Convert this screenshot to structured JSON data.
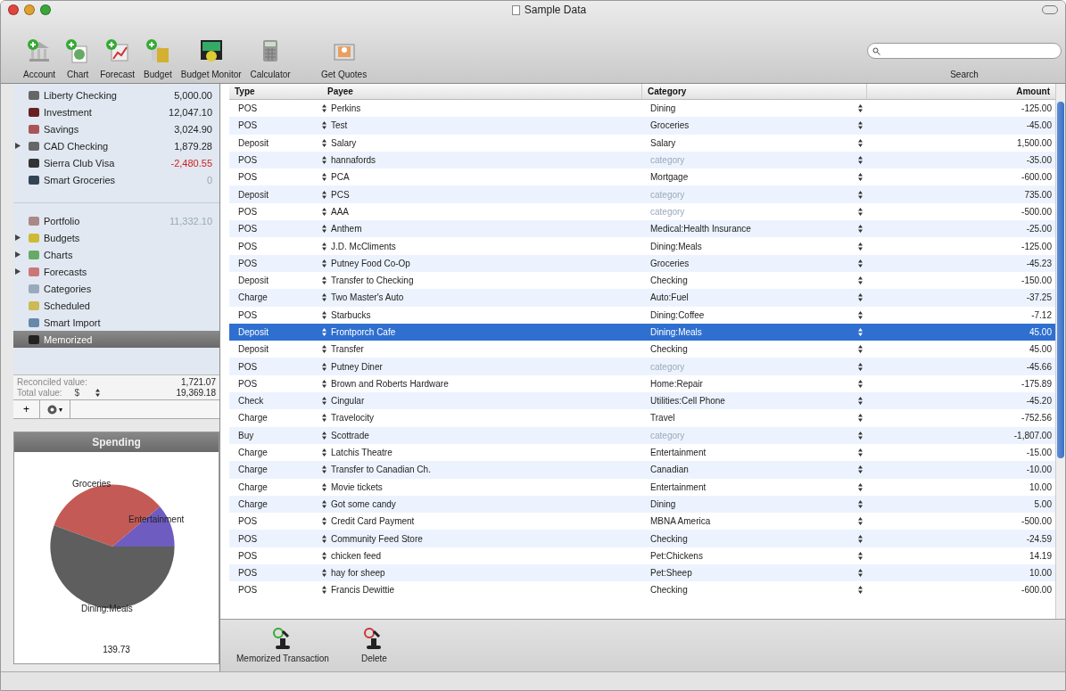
{
  "window": {
    "title": "Sample Data"
  },
  "toolbar": {
    "buttons": [
      {
        "label": "Account"
      },
      {
        "label": "Chart"
      },
      {
        "label": "Forecast"
      },
      {
        "label": "Budget"
      },
      {
        "label": "Budget Monitor"
      },
      {
        "label": "Calculator"
      },
      {
        "label": "Get Quotes"
      }
    ],
    "search": {
      "label": "Search"
    }
  },
  "sidebar": {
    "accounts": [
      {
        "label": "Liberty Checking",
        "amount": "5,000.00",
        "negative": false,
        "dimmed": false,
        "expandable": false,
        "selected": false
      },
      {
        "label": "Investment",
        "amount": "12,047.10",
        "negative": false,
        "dimmed": false,
        "expandable": false,
        "selected": false
      },
      {
        "label": "Savings",
        "amount": "3,024.90",
        "negative": false,
        "dimmed": false,
        "expandable": false,
        "selected": false
      },
      {
        "label": "CAD Checking",
        "amount": "1,879.28",
        "negative": false,
        "dimmed": false,
        "expandable": true,
        "selected": false
      },
      {
        "label": "Sierra Club Visa",
        "amount": "-2,480.55",
        "negative": true,
        "dimmed": false,
        "expandable": false,
        "selected": false
      },
      {
        "label": "Smart Groceries",
        "amount": "0",
        "negative": false,
        "dimmed": true,
        "expandable": false,
        "selected": false
      }
    ],
    "items": [
      {
        "label": "Portfolio",
        "amount": "11,332.10",
        "negative": false,
        "dimmed": true,
        "expandable": false,
        "selected": false
      },
      {
        "label": "Budgets",
        "expandable": true,
        "selected": false
      },
      {
        "label": "Charts",
        "expandable": true,
        "selected": false
      },
      {
        "label": "Forecasts",
        "expandable": true,
        "selected": false
      },
      {
        "label": "Categories",
        "expandable": false,
        "selected": false
      },
      {
        "label": "Scheduled",
        "expandable": false,
        "selected": false
      },
      {
        "label": "Smart Import",
        "expandable": false,
        "selected": false
      },
      {
        "label": "Memorized",
        "expandable": false,
        "selected": true
      }
    ],
    "summary": {
      "reconciled_label": "Reconciled value:",
      "reconciled": "1,721.07",
      "total_label": "Total value:",
      "currency": "$",
      "total": "19,369.18"
    },
    "actions": [
      {
        "label": "+"
      },
      {
        "label": "▾"
      }
    ]
  },
  "spending": {
    "title": "Spending",
    "slices": [
      {
        "label": "Groceries",
        "color": "#c45a55"
      },
      {
        "label": "Entertainment",
        "color": "#6e5cc0"
      },
      {
        "label": "Dining:Meals",
        "color": "#5e5e5e"
      }
    ],
    "total": "139.73"
  },
  "table": {
    "columns": [
      "Type",
      "Payee",
      "Category",
      "Amount"
    ],
    "rows": [
      {
        "type": "POS",
        "payee": "Perkins",
        "category": "Dining",
        "amount": "-125.00",
        "selected": false
      },
      {
        "type": "POS",
        "payee": "Test",
        "category": "Groceries",
        "amount": "-45.00",
        "selected": false
      },
      {
        "type": "Deposit",
        "payee": "Salary",
        "category": "Salary",
        "amount": "1,500.00",
        "selected": false
      },
      {
        "type": "POS",
        "payee": "hannafords",
        "category_placeholder": "category",
        "amount": "-35.00",
        "selected": false
      },
      {
        "type": "POS",
        "payee": "PCA",
        "category": "Mortgage",
        "amount": "-600.00",
        "selected": false
      },
      {
        "type": "Deposit",
        "payee": "PCS",
        "category_placeholder": "category",
        "amount": "735.00",
        "selected": false
      },
      {
        "type": "POS",
        "payee": "AAA",
        "category_placeholder": "category",
        "amount": "-500.00",
        "selected": false
      },
      {
        "type": "POS",
        "payee": "Anthem",
        "category": "Medical:Health Insurance",
        "amount": "-25.00",
        "selected": false
      },
      {
        "type": "POS",
        "payee": "J.D. McCliments",
        "category": "Dining:Meals",
        "amount": "-125.00",
        "selected": false
      },
      {
        "type": "POS",
        "payee": "Putney Food Co-Op",
        "category": "Groceries",
        "amount": "-45.23",
        "selected": false
      },
      {
        "type": "Deposit",
        "payee": "Transfer to Checking",
        "category": "Checking",
        "amount": "-150.00",
        "selected": false
      },
      {
        "type": "Charge",
        "payee": "Two Master's Auto",
        "category": "Auto:Fuel",
        "amount": "-37.25",
        "selected": false
      },
      {
        "type": "POS",
        "payee": "Starbucks",
        "category": "Dining:Coffee",
        "amount": "-7.12",
        "selected": false
      },
      {
        "type": "Deposit",
        "payee": "Frontporch Cafe",
        "category": "Dining:Meals",
        "amount": "45.00",
        "selected": true
      },
      {
        "type": "Deposit",
        "payee": "Transfer",
        "category": "Checking",
        "amount": "45.00",
        "selected": false
      },
      {
        "type": "POS",
        "payee": "Putney Diner",
        "category_placeholder": "category",
        "amount": "-45.66",
        "selected": false
      },
      {
        "type": "POS",
        "payee": "Brown and Roberts Hardware",
        "category": "Home:Repair",
        "amount": "-175.89",
        "selected": false
      },
      {
        "type": "Check",
        "payee": "Cingular",
        "category": "Utilities:Cell Phone",
        "amount": "-45.20",
        "selected": false
      },
      {
        "type": "Charge",
        "payee": "Travelocity",
        "category": "Travel",
        "amount": "-752.56",
        "selected": false
      },
      {
        "type": "Buy",
        "payee": "Scottrade",
        "category_placeholder": "category",
        "amount": "-1,807.00",
        "selected": false
      },
      {
        "type": "Charge",
        "payee": "Latchis Theatre",
        "category": "Entertainment",
        "amount": "-15.00",
        "selected": false
      },
      {
        "type": "Charge",
        "payee": "Transfer to Canadian Ch.",
        "category": "Canadian",
        "amount": "-10.00",
        "selected": false
      },
      {
        "type": "Charge",
        "payee": "Movie tickets",
        "category": "Entertainment",
        "amount": "10.00",
        "selected": false
      },
      {
        "type": "Charge",
        "payee": "Got some candy",
        "category": "Dining",
        "amount": "5.00",
        "selected": false
      },
      {
        "type": "POS",
        "payee": "Credit Card Payment",
        "category": "MBNA America",
        "amount": "-500.00",
        "selected": false
      },
      {
        "type": "POS",
        "payee": "Community Feed Store",
        "category": "Checking",
        "amount": "-24.59",
        "selected": false
      },
      {
        "type": "POS",
        "payee": "chicken feed",
        "category": "Pet:Chickens",
        "amount": "14.19",
        "selected": false
      },
      {
        "type": "POS",
        "payee": "hay for sheep",
        "category": "Pet:Sheep",
        "amount": "10.00",
        "selected": false
      },
      {
        "type": "POS",
        "payee": "Francis Dewittie",
        "category": "Checking",
        "amount": "-600.00",
        "selected": false
      }
    ]
  },
  "bottom_toolbar": {
    "buttons": [
      {
        "label": "Memorized Transaction"
      },
      {
        "label": "Delete"
      }
    ]
  }
}
